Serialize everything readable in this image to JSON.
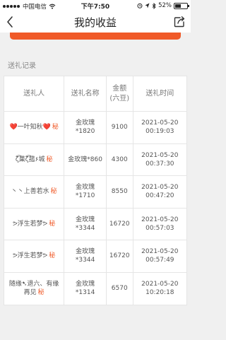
{
  "status_bar": {
    "carrier": "中国电信",
    "time": "下午7:50",
    "battery": "52%",
    "battery_fraction": 0.52
  },
  "nav": {
    "title": "我的收益"
  },
  "section": {
    "title": "送礼记录"
  },
  "table": {
    "headers": {
      "sender": "送礼人",
      "gift": "送礼名称",
      "amount": "金额(六豆)",
      "time": "送礼时间"
    },
    "rows": [
      {
        "sender": "❤️一叶知秋❤️",
        "tag": "秘",
        "gift": "金玫瑰*1820",
        "amount": "9100",
        "time": "2021-05-20 00:19:03"
      },
      {
        "sender": "ζ͡菓ζ͡菰۶城",
        "tag": "秘",
        "gift": "金玫瑰*860",
        "amount": "4300",
        "time": "2021-05-20 00:37:30"
      },
      {
        "sender": "丶丶上善若水",
        "tag": "秘",
        "gift": "金玫瑰*1710",
        "amount": "8550",
        "time": "2021-05-20 00:47:20"
      },
      {
        "sender": "ᕗ浮生若梦ᕗ",
        "tag": "秘",
        "gift": "金玫瑰*3344",
        "amount": "16720",
        "time": "2021-05-20 00:57:03"
      },
      {
        "sender": "ᕗ浮生若梦ᕗ",
        "tag": "秘",
        "gift": "金玫瑰*3344",
        "amount": "16720",
        "time": "2021-05-20 00:57:49"
      },
      {
        "sender": "随缘➷退六、有缘再见",
        "tag": "秘",
        "gift": "金玫瑰*1314",
        "amount": "6570",
        "time": "2021-05-20 10:20:18"
      }
    ]
  },
  "colors": {
    "accent": "#f05a28",
    "background": "#f0f0f0"
  },
  "icons": {
    "back": "chevron-left-icon",
    "share": "share-icon",
    "wifi": "wifi-icon",
    "location": "location-icon",
    "bluetooth": "bluetooth-icon",
    "battery": "battery-icon"
  }
}
